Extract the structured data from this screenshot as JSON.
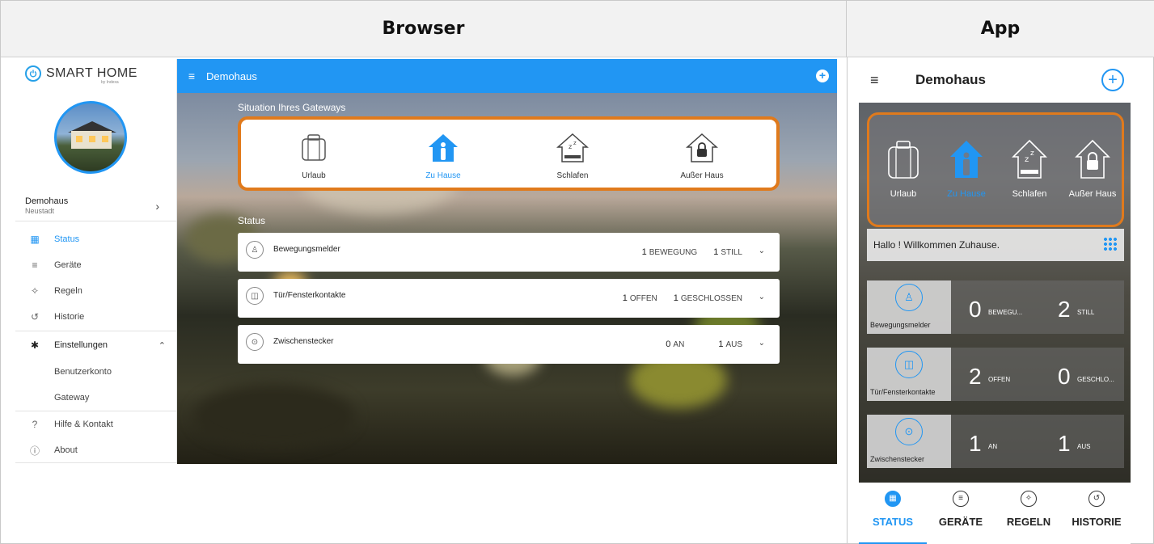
{
  "headers": {
    "browser": "Browser",
    "app": "App"
  },
  "browser": {
    "logo": {
      "text": "SMART HOME",
      "sub": "by Indexa"
    },
    "location": {
      "name": "Demohaus",
      "city": "Neustadt"
    },
    "nav": [
      {
        "label": "Status",
        "icon": "dashboard-icon",
        "active": true
      },
      {
        "label": "Geräte",
        "icon": "list-icon"
      },
      {
        "label": "Regeln",
        "icon": "wand-icon"
      },
      {
        "label": "Historie",
        "icon": "history-icon"
      },
      {
        "label": "Einstellungen",
        "icon": "gear-icon"
      },
      {
        "label": "Benutzerkonto"
      },
      {
        "label": "Gateway"
      },
      {
        "label": "Hilfe & Kontakt",
        "icon": "help-icon"
      },
      {
        "label": "About",
        "icon": "info-icon"
      }
    ],
    "topbar": {
      "title": "Demohaus"
    },
    "gateway": {
      "title": "Situation Ihres Gateways",
      "items": [
        {
          "label": "Urlaub",
          "icon": "suitcase-icon"
        },
        {
          "label": "Zu Hause",
          "icon": "home-person-icon",
          "active": true
        },
        {
          "label": "Schlafen",
          "icon": "sleep-house-icon"
        },
        {
          "label": "Außer Haus",
          "icon": "lock-house-icon"
        }
      ]
    },
    "status": {
      "title": "Status",
      "rows": [
        {
          "name": "Bewegungsmelder",
          "icon": "motion-sensor-icon",
          "v1": "1",
          "u1": "BEWEGUNG",
          "v2": "1",
          "u2": "STILL"
        },
        {
          "name": "Tür/Fensterkontakte",
          "icon": "door-window-icon",
          "v1": "1",
          "u1": "OFFEN",
          "v2": "1",
          "u2": "GESCHLOSSEN"
        },
        {
          "name": "Zwischenstecker",
          "icon": "plug-icon",
          "v1": "0",
          "u1": "AN",
          "v2": "1",
          "u2": "AUS"
        }
      ]
    }
  },
  "app": {
    "title": "Demohaus",
    "gateway": [
      {
        "label": "Urlaub"
      },
      {
        "label": "Zu Hause",
        "active": true
      },
      {
        "label": "Schlafen"
      },
      {
        "label": "Außer Haus"
      }
    ],
    "hello": "Hallo ! Willkommen Zuhause.",
    "cards": [
      {
        "name": "Bewegungsmelder",
        "v1": "0",
        "u1": "BEWEGU...",
        "v2": "2",
        "u2": "STILL"
      },
      {
        "name": "Tür/Fensterkontakte",
        "v1": "2",
        "u1": "OFFEN",
        "v2": "0",
        "u2": "GESCHLO..."
      },
      {
        "name": "Zwischenstecker",
        "v1": "1",
        "u1": "AN",
        "v2": "1",
        "u2": "AUS"
      }
    ],
    "tabs": [
      {
        "label": "STATUS",
        "active": true
      },
      {
        "label": "GERÄTE"
      },
      {
        "label": "REGELN"
      },
      {
        "label": "HISTORIE"
      }
    ]
  },
  "colors": {
    "accent": "#2196f3",
    "highlight": "#e07a1c"
  }
}
